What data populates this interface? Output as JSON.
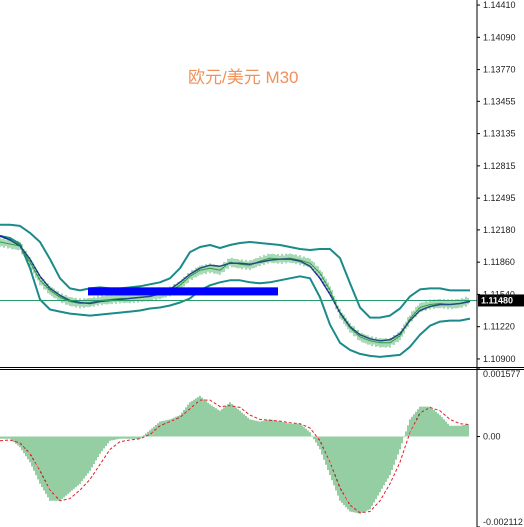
{
  "chart_data": [
    {
      "type": "line",
      "title": "欧元/美元 M30",
      "ylim": [
        1.1083,
        1.1446
      ],
      "y_ticks": [
        "1.14410",
        "1.14090",
        "1.13770",
        "1.13455",
        "1.13135",
        "1.12815",
        "1.12495",
        "1.12180",
        "1.11860",
        "1.11540",
        "1.11220",
        "1.10900"
      ],
      "current_price": "1.11480",
      "horizontal_line": 1.1148,
      "highlight_box": {
        "x_range": [
          88,
          278
        ],
        "y_range": [
          1.1153,
          1.1161
        ],
        "color": "#0000ff"
      },
      "colors": {
        "bands": "#1a8a8a",
        "price": "#2c9e4a",
        "ma": "#1a1aa0",
        "grid_line": "#2a9a6a"
      },
      "series": [
        {
          "role": "price",
          "x": [
            0,
            10,
            20,
            30,
            40,
            50,
            60,
            70,
            80,
            90,
            100,
            110,
            120,
            130,
            140,
            150,
            160,
            170,
            180,
            190,
            200,
            210,
            220,
            230,
            240,
            250,
            260,
            270,
            280,
            290,
            300,
            310,
            320,
            330,
            340,
            350,
            360,
            370,
            380,
            390,
            400,
            410,
            420,
            430,
            440,
            450,
            460,
            470
          ],
          "values": [
            1.1206,
            1.1204,
            1.1202,
            1.1186,
            1.1168,
            1.1158,
            1.1151,
            1.1147,
            1.1145,
            1.1146,
            1.1148,
            1.1149,
            1.115,
            1.115,
            1.1151,
            1.1152,
            1.1154,
            1.1157,
            1.1163,
            1.1172,
            1.1178,
            1.118,
            1.1178,
            1.1186,
            1.1184,
            1.1183,
            1.1187,
            1.119,
            1.1189,
            1.119,
            1.1188,
            1.1185,
            1.1175,
            1.1158,
            1.1135,
            1.1121,
            1.1112,
            1.1108,
            1.1106,
            1.1106,
            1.1113,
            1.113,
            1.1141,
            1.1144,
            1.1145,
            1.1144,
            1.1145,
            1.1148
          ]
        },
        {
          "role": "middle-band",
          "x": [
            0,
            10,
            20,
            30,
            40,
            50,
            60,
            70,
            80,
            90,
            100,
            110,
            120,
            130,
            140,
            150,
            160,
            170,
            180,
            190,
            200,
            210,
            220,
            230,
            240,
            250,
            260,
            270,
            280,
            290,
            300,
            310,
            320,
            330,
            340,
            350,
            360,
            370,
            380,
            390,
            400,
            410,
            420,
            430,
            440,
            450,
            460,
            470
          ],
          "values": [
            1.1212,
            1.1208,
            1.1202,
            1.1189,
            1.1172,
            1.116,
            1.1153,
            1.1148,
            1.1146,
            1.1145,
            1.1147,
            1.1148,
            1.1149,
            1.115,
            1.1151,
            1.1152,
            1.1155,
            1.1159,
            1.1166,
            1.1174,
            1.118,
            1.1183,
            1.1182,
            1.1185,
            1.1185,
            1.1184,
            1.1186,
            1.1188,
            1.1189,
            1.1189,
            1.1187,
            1.1182,
            1.117,
            1.1154,
            1.1136,
            1.1122,
            1.1114,
            1.111,
            1.1108,
            1.1109,
            1.1115,
            1.1128,
            1.1138,
            1.1142,
            1.1144,
            1.1144,
            1.1145,
            1.1147
          ]
        },
        {
          "role": "upper-band",
          "x": [
            0,
            10,
            20,
            30,
            40,
            50,
            60,
            70,
            80,
            90,
            100,
            110,
            120,
            130,
            140,
            150,
            160,
            170,
            180,
            190,
            200,
            210,
            220,
            230,
            240,
            250,
            260,
            270,
            280,
            290,
            300,
            310,
            320,
            330,
            340,
            350,
            360,
            370,
            380,
            390,
            400,
            410,
            420,
            430,
            440,
            450,
            460,
            470
          ],
          "values": [
            1.1223,
            1.1223,
            1.1222,
            1.1215,
            1.1206,
            1.1189,
            1.117,
            1.116,
            1.1158,
            1.116,
            1.1161,
            1.116,
            1.116,
            1.1161,
            1.1162,
            1.1164,
            1.1166,
            1.117,
            1.118,
            1.1196,
            1.1201,
            1.1203,
            1.12,
            1.1203,
            1.1205,
            1.1206,
            1.1205,
            1.1204,
            1.1203,
            1.1201,
            1.1199,
            1.1198,
            1.1199,
            1.1199,
            1.119,
            1.1165,
            1.1141,
            1.1131,
            1.1131,
            1.1133,
            1.114,
            1.1152,
            1.1159,
            1.116,
            1.116,
            1.1158,
            1.1158,
            1.1158
          ]
        },
        {
          "role": "lower-band",
          "x": [
            0,
            10,
            20,
            30,
            40,
            50,
            60,
            70,
            80,
            90,
            100,
            110,
            120,
            130,
            140,
            150,
            160,
            170,
            180,
            190,
            200,
            210,
            220,
            230,
            240,
            250,
            260,
            270,
            280,
            290,
            300,
            310,
            320,
            330,
            340,
            350,
            360,
            370,
            380,
            390,
            400,
            410,
            420,
            430,
            440,
            450,
            460,
            470
          ],
          "values": [
            1.1212,
            1.121,
            1.1204,
            1.118,
            1.1149,
            1.1139,
            1.1137,
            1.1135,
            1.1134,
            1.1133,
            1.1134,
            1.1135,
            1.1136,
            1.1137,
            1.1138,
            1.114,
            1.1141,
            1.1143,
            1.1146,
            1.115,
            1.1158,
            1.1163,
            1.1166,
            1.1168,
            1.1168,
            1.1166,
            1.1165,
            1.1166,
            1.1168,
            1.117,
            1.1172,
            1.117,
            1.1151,
            1.1124,
            1.1106,
            1.1099,
            1.1095,
            1.1093,
            1.1092,
            1.1093,
            1.1094,
            1.1102,
            1.1114,
            1.1123,
            1.1127,
            1.1128,
            1.1128,
            1.113
          ]
        }
      ]
    },
    {
      "type": "bar",
      "ylim": [
        -0.002112,
        0.001577
      ],
      "y_ticks": [
        "0.001577",
        "0.00",
        "-0.002112"
      ],
      "colors": {
        "bars": "#2c9e4a",
        "signal": "#e0202a"
      },
      "series": [
        {
          "role": "histogram",
          "x": [
            0,
            10,
            20,
            30,
            40,
            50,
            60,
            70,
            80,
            90,
            100,
            110,
            120,
            130,
            140,
            150,
            160,
            170,
            180,
            190,
            200,
            210,
            220,
            230,
            240,
            250,
            260,
            270,
            280,
            290,
            300,
            310,
            320,
            330,
            340,
            350,
            360,
            370,
            380,
            390,
            400,
            410,
            420,
            430,
            440,
            450,
            460,
            470
          ],
          "values": [
            -5e-05,
            -5e-05,
            -0.00025,
            -0.0006,
            -0.0011,
            -0.0015,
            -0.0015,
            -0.0013,
            -0.0011,
            -0.0008,
            -0.0004,
            -0.0001,
            -5e-05,
            -5e-05,
            -5e-05,
            0.00015,
            0.00035,
            0.0004,
            0.0005,
            0.0008,
            0.00095,
            0.00075,
            0.0006,
            0.0008,
            0.0006,
            0.0004,
            0.00035,
            0.0004,
            0.00035,
            0.0003,
            0.0003,
            0.0001,
            -0.0003,
            -0.0009,
            -0.0015,
            -0.00175,
            -0.0018,
            -0.0017,
            -0.0013,
            -0.0009,
            -0.0003,
            0.0004,
            0.0007,
            0.0007,
            0.0005,
            0.00025,
            0.00025,
            0.0003
          ]
        },
        {
          "role": "signal",
          "x": [
            0,
            10,
            20,
            30,
            40,
            50,
            60,
            70,
            80,
            90,
            100,
            110,
            120,
            130,
            140,
            150,
            160,
            170,
            180,
            190,
            200,
            210,
            220,
            230,
            240,
            250,
            260,
            270,
            280,
            290,
            300,
            310,
            320,
            330,
            340,
            350,
            360,
            370,
            380,
            390,
            400,
            410,
            420,
            430,
            440,
            450,
            460,
            470
          ],
          "values": [
            -0.0001,
            -8e-05,
            -0.00015,
            -0.0004,
            -0.0008,
            -0.00125,
            -0.0015,
            -0.00145,
            -0.00125,
            -0.001,
            -0.00065,
            -0.0003,
            -0.00012,
            -8e-05,
            -5e-05,
            5e-05,
            0.00025,
            0.00035,
            0.00045,
            0.00065,
            0.00085,
            0.00085,
            0.0007,
            0.00072,
            0.00068,
            0.0005,
            0.0004,
            0.00038,
            0.00036,
            0.00032,
            0.0003,
            0.0002,
            -0.0001,
            -0.0006,
            -0.0012,
            -0.0016,
            -0.00178,
            -0.00175,
            -0.0015,
            -0.0011,
            -0.0006,
            0.0001,
            0.00055,
            0.00068,
            0.0006,
            0.0004,
            0.0003,
            0.00028
          ]
        }
      ]
    }
  ]
}
